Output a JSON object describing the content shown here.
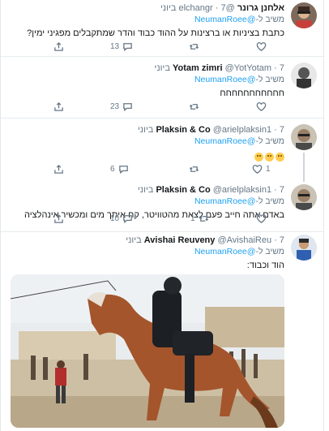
{
  "tweets": [
    {
      "name": "אלחנן גרונר",
      "handle": "@elchangr",
      "time": "7 ביוני",
      "reply_label": "משיב ל-",
      "reply_mention": "@NeumanRoee",
      "text": "כתבת בציניות או ברצינות על ההוד כבוד והדר שמתקבלים מפגיני ימין?",
      "comments": "13",
      "retweets": "",
      "likes": ""
    },
    {
      "name": "Yotam zimri",
      "handle": "@YotYotam",
      "time": "7 ביוני",
      "reply_label": "משיב ל-",
      "reply_mention": "@NeumanRoee",
      "text": "חחחחחחחחחחח",
      "comments": "23",
      "retweets": "",
      "likes": ""
    },
    {
      "name": "Plaksin & Co",
      "handle": "@arielplaksin1",
      "time": "7 ביוני",
      "reply_label": "משיב ל-",
      "reply_mention": "@NeumanRoee",
      "text": "",
      "emoji_count": 3,
      "comments": "6",
      "retweets": "",
      "likes": "1"
    },
    {
      "name": "Plaksin & Co",
      "handle": "@arielplaksin1",
      "time": "7 ביוני",
      "reply_label": "משיב ל-",
      "reply_mention": "@NeumanRoee",
      "text": "באדם אתה חייב פעם לצאת מהטוויטר, קח איתך מים ומכשיר אינהלציה",
      "comments": "10",
      "retweets": "1",
      "likes": ""
    },
    {
      "name": "Avishai Reuveny",
      "handle": "@AvishaiReu",
      "time": "7 ביוני",
      "reply_label": "משיב ל-",
      "reply_mention": "@NeumanRoee",
      "text": "הוד וכבוד:"
    }
  ],
  "icons": {
    "comment": "comment-icon",
    "retweet": "retweet-icon",
    "like": "heart-icon",
    "share": "share-icon"
  },
  "colors": {
    "link": "#1da1f2",
    "muted": "#657786",
    "text": "#14171a",
    "divider": "#e6ecf0"
  }
}
